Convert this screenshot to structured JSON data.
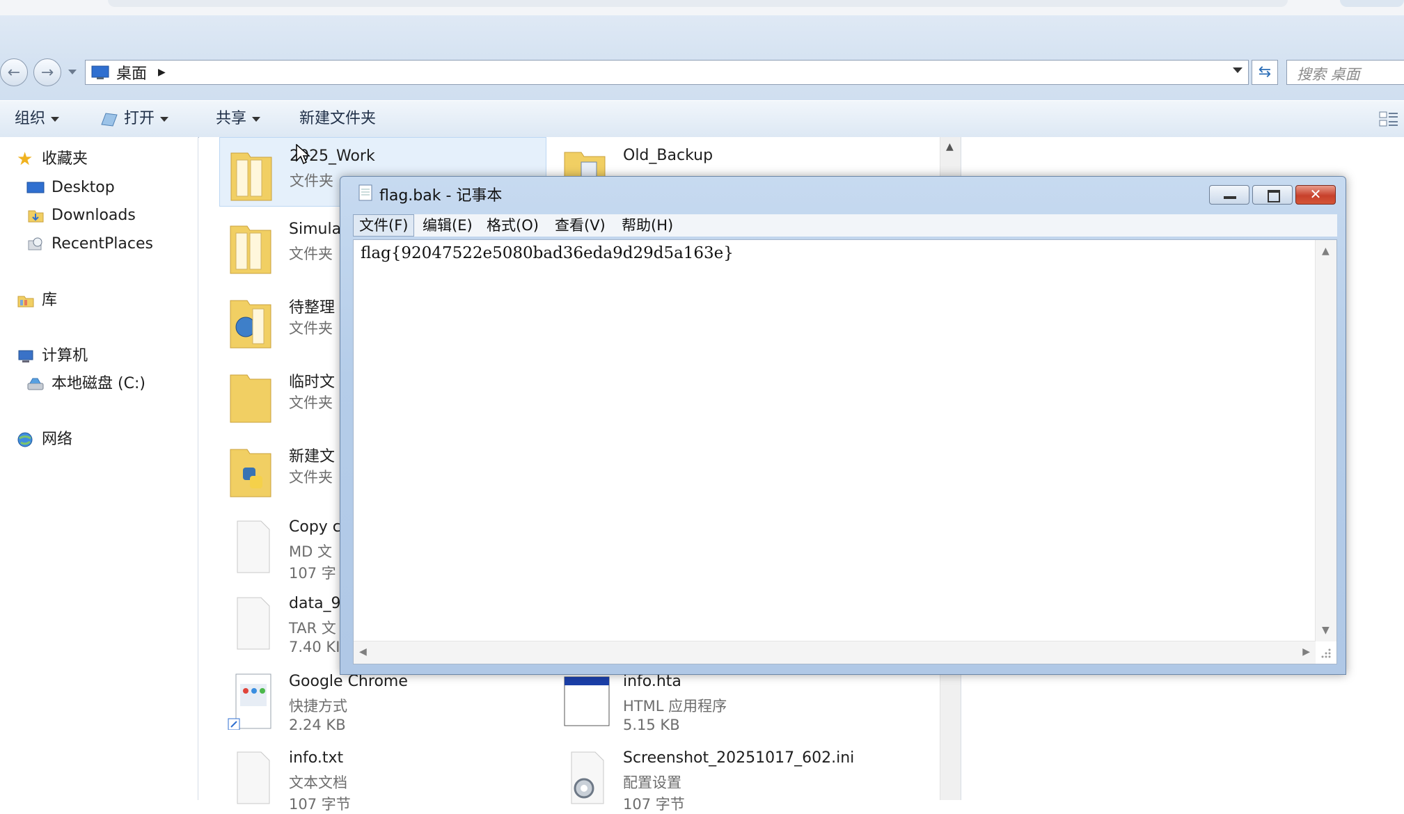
{
  "address": {
    "location": "桌面",
    "search_placeholder": "搜索 桌面"
  },
  "toolbar": {
    "organize": "组织",
    "open": "打开",
    "share": "共享",
    "new_folder": "新建文件夹"
  },
  "nav": {
    "favorites": "收藏夹",
    "fav_items": [
      "Desktop",
      "Downloads",
      "RecentPlaces"
    ],
    "libraries": "库",
    "computer": "计算机",
    "drive": "本地磁盘 (C:)",
    "network": "网络"
  },
  "files": [
    {
      "name": "2025_Work",
      "type": "文件夹",
      "size": ""
    },
    {
      "name": "Old_Backup",
      "type": "",
      "size": ""
    },
    {
      "name": "Simula",
      "type": "文件夹",
      "size": ""
    },
    {
      "name": "待整理",
      "type": "文件夹",
      "size": ""
    },
    {
      "name": "临时文",
      "type": "文件夹",
      "size": ""
    },
    {
      "name": "新建文",
      "type": "文件夹",
      "size": ""
    },
    {
      "name": "Copy c",
      "type": "MD 文",
      "size": "107 字"
    },
    {
      "name": "data_9",
      "type": "TAR 文",
      "size": "7.40 KI"
    },
    {
      "name": "Google Chrome",
      "type": "快捷方式",
      "size": "2.24 KB"
    },
    {
      "name": "info.hta",
      "type": "HTML 应用程序",
      "size": "5.15 KB"
    },
    {
      "name": "info.txt",
      "type": "文本文档",
      "size": "107 字节"
    },
    {
      "name": "Screenshot_20251017_602.ini",
      "type": "配置设置",
      "size": "107 字节"
    }
  ],
  "notepad": {
    "title": "flag.bak - 记事本",
    "menu": [
      "文件(F)",
      "编辑(E)",
      "格式(O)",
      "查看(V)",
      "帮助(H)"
    ],
    "content": "flag{92047522e5080bad36eda9d29d5a163e}"
  },
  "colors": {
    "accent": "#2d6fb8",
    "close": "#c7402b",
    "selection": "#e5f0fb"
  }
}
